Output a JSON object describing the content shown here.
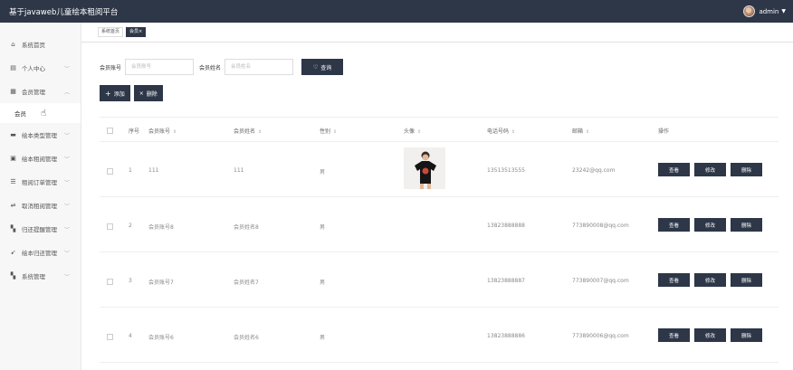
{
  "header": {
    "title": "基于javaweb儿童绘本租阅平台",
    "username": "admin"
  },
  "sidebar": {
    "items": [
      {
        "icon": "home-icon",
        "glyph": "⌂",
        "label": "系统首页",
        "chev": ""
      },
      {
        "icon": "calendar-icon",
        "glyph": "▤",
        "label": "个人中心",
        "chev": "﹀"
      },
      {
        "icon": "grid-icon",
        "glyph": "▦",
        "label": "会员管理",
        "chev": "︿"
      },
      {
        "icon": "bank-icon",
        "glyph": "▬",
        "label": "绘本类型管理",
        "chev": "﹀"
      },
      {
        "icon": "book-icon",
        "glyph": "▣",
        "label": "绘本租阅管理",
        "chev": "﹀"
      },
      {
        "icon": "list-icon",
        "glyph": "☰",
        "label": "租阅订单管理",
        "chev": "﹀"
      },
      {
        "icon": "sliders-icon",
        "glyph": "⇌",
        "label": "取消租阅管理",
        "chev": "﹀"
      },
      {
        "icon": "apps-icon",
        "glyph": "▚",
        "label": "归还提醒管理",
        "chev": "﹀"
      },
      {
        "icon": "send-icon",
        "glyph": "➹",
        "label": "绘本归还管理",
        "chev": "﹀"
      },
      {
        "icon": "settings-grid-icon",
        "glyph": "▚",
        "label": "系统管理",
        "chev": "﹀"
      }
    ],
    "sub_item": "会员"
  },
  "tabs": [
    {
      "label": "系统首页",
      "active": false
    },
    {
      "label": "会员×",
      "active": true
    }
  ],
  "search": {
    "account_label": "会员账号",
    "account_placeholder": "会员账号",
    "name_label": "会员姓名",
    "name_placeholder": "会员姓名",
    "query_label": "查询"
  },
  "toolbar": {
    "add_label": "添加",
    "delete_label": "删除"
  },
  "table": {
    "columns": [
      "序号",
      "会员账号",
      "会员姓名",
      "性别",
      "头像",
      "电话号码",
      "邮箱",
      "操作"
    ],
    "sort_mark": "⇕",
    "rows": [
      {
        "index": "1",
        "account": "111",
        "name": "111",
        "gender": "男",
        "has_photo": true,
        "phone": "13513513555",
        "email": "23242@qq.com"
      },
      {
        "index": "2",
        "account": "会员账号8",
        "name": "会员姓名8",
        "gender": "男",
        "has_photo": false,
        "phone": "13823888888",
        "email": "773890008@qq.com"
      },
      {
        "index": "3",
        "account": "会员账号7",
        "name": "会员姓名7",
        "gender": "男",
        "has_photo": false,
        "phone": "13823888887",
        "email": "773890007@qq.com"
      },
      {
        "index": "4",
        "account": "会员账号6",
        "name": "会员姓名6",
        "gender": "男",
        "has_photo": false,
        "phone": "13823888886",
        "email": "773890006@qq.com"
      }
    ],
    "actions": {
      "view": "查看",
      "edit": "修改",
      "delete": "删除"
    }
  },
  "colors": {
    "header_bg": "#2d3748",
    "button_bg": "#2d3748",
    "sidebar_bg": "#f7f7f7"
  }
}
